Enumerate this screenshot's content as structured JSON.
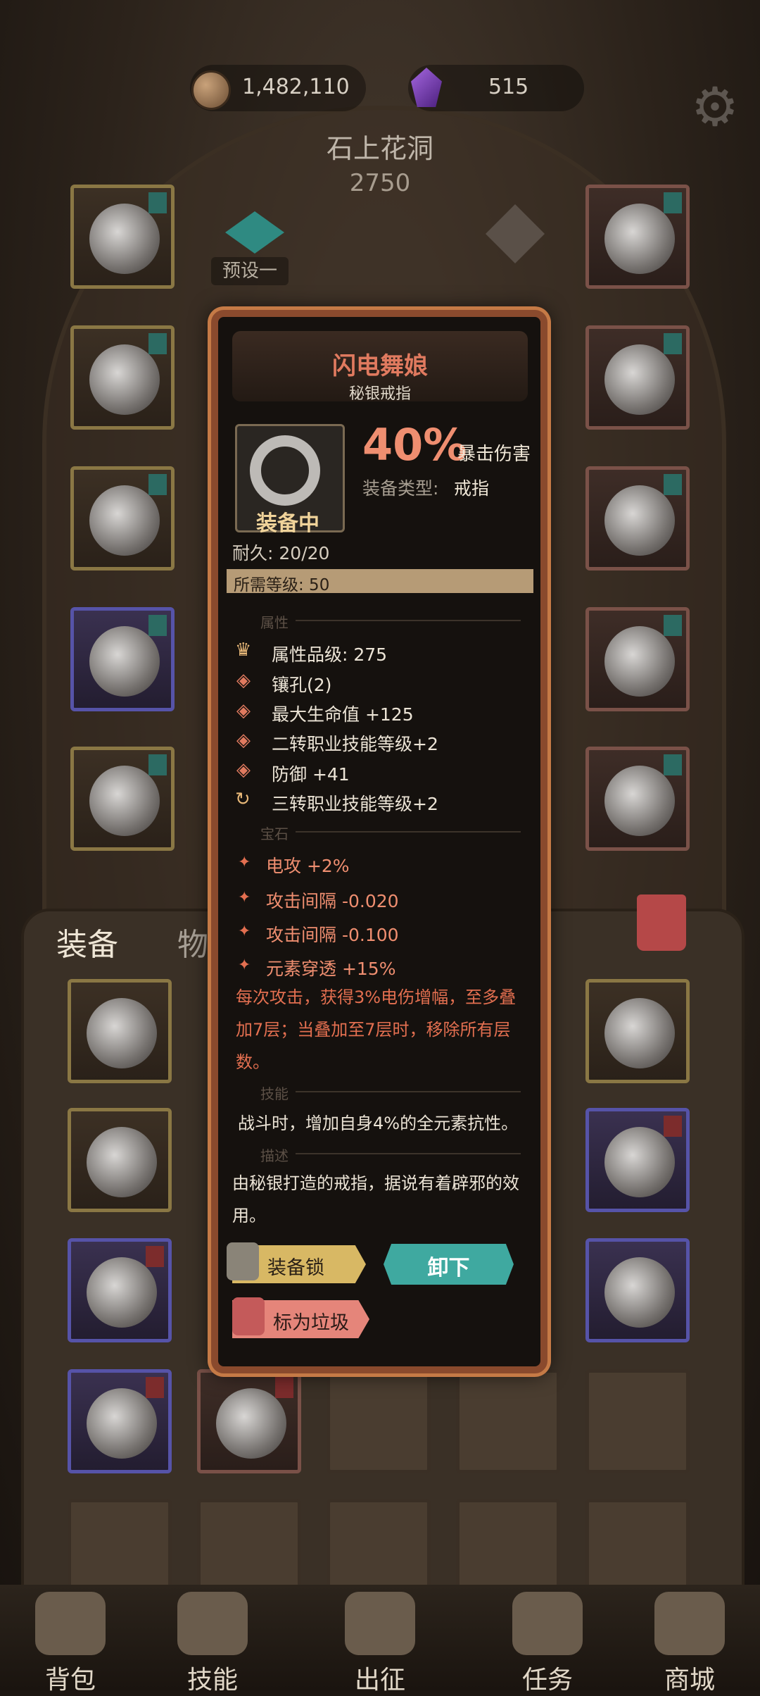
{
  "currency": {
    "gold": "1,482,110",
    "gems": "515",
    "gold_icon": "coin-icon",
    "gem_icon": "purple-crystal-icon"
  },
  "location": {
    "name": "石上花洞",
    "level": "2750"
  },
  "preset": {
    "label": "预设一"
  },
  "tabs": {
    "equipment": "装备",
    "items": "物品"
  },
  "tooltip": {
    "name": "闪电舞娘",
    "subtitle": "秘银戒指",
    "equipped_label": "装备中",
    "main_stat_value": "40%",
    "main_stat_label": "暴击伤害",
    "type_label": "装备类型:",
    "type_value": "戒指",
    "durability_label": "耐久:",
    "durability_value": "20/20",
    "required_level": "所需等级: 50",
    "section_attributes": "属性",
    "attributes": [
      "属性品级: 275",
      "镶孔(2)",
      "最大生命值 +125",
      "二转职业技能等级+2",
      "防御 +41",
      "三转职业技能等级+2"
    ],
    "section_gems": "宝石",
    "gems": [
      "电攻 +2%",
      "攻击间隔 -0.020",
      "攻击间隔 -0.100",
      "元素穿透 +15%"
    ],
    "effect_text": "每次攻击，获得3%电伤增幅，至多叠加7层；当叠加至7层时，移除所有层数。",
    "section_skill": "技能",
    "skill_text": "战斗时，增加自身4%的全元素抗性。",
    "section_desc": "描述",
    "desc_text": "由秘银打造的戒指，据说有着辟邪的效用。",
    "btn_lock": "装备锁",
    "btn_unequip": "卸下",
    "btn_junk": "标为垃圾"
  },
  "nav": [
    "背包",
    "技能",
    "出征",
    "任务",
    "商城"
  ],
  "colors": {
    "accent_teal": "#3fa9a0",
    "accent_red": "#e07a5f",
    "frame_gold": "#8a7744",
    "frame_purple": "#5653a8"
  }
}
